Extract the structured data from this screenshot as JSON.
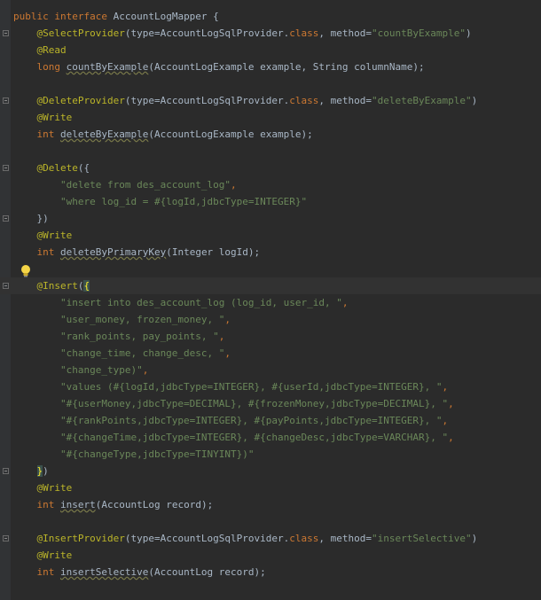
{
  "editor": {
    "lines": [
      {
        "tokens": [
          {
            "t": "public interface ",
            "c": "kw"
          },
          {
            "t": "AccountLogMapper {",
            "c": "cls"
          }
        ]
      },
      {
        "tokens": [
          {
            "t": "    @SelectProvider",
            "c": "ann"
          },
          {
            "t": "(type=AccountLogSqlProvider.",
            "c": "cls"
          },
          {
            "t": "class",
            "c": "kw"
          },
          {
            "t": ", method=",
            "c": "cls"
          },
          {
            "t": "\"countByExample\"",
            "c": "str"
          },
          {
            "t": ")",
            "c": "cls"
          }
        ]
      },
      {
        "tokens": [
          {
            "t": "    @Read",
            "c": "ann"
          }
        ]
      },
      {
        "tokens": [
          {
            "t": "    long ",
            "c": "kw"
          },
          {
            "t": "countByExample",
            "c": "meth"
          },
          {
            "t": "(AccountLogExample example, String columnName);",
            "c": "cls"
          }
        ]
      },
      {
        "tokens": []
      },
      {
        "tokens": [
          {
            "t": "    @DeleteProvider",
            "c": "ann"
          },
          {
            "t": "(type=AccountLogSqlProvider.",
            "c": "cls"
          },
          {
            "t": "class",
            "c": "kw"
          },
          {
            "t": ", method=",
            "c": "cls"
          },
          {
            "t": "\"deleteByExample\"",
            "c": "str"
          },
          {
            "t": ")",
            "c": "cls"
          }
        ]
      },
      {
        "tokens": [
          {
            "t": "    @Write",
            "c": "ann"
          }
        ]
      },
      {
        "tokens": [
          {
            "t": "    int ",
            "c": "kw"
          },
          {
            "t": "deleteByExample",
            "c": "meth"
          },
          {
            "t": "(AccountLogExample example);",
            "c": "cls"
          }
        ]
      },
      {
        "tokens": []
      },
      {
        "tokens": [
          {
            "t": "    @Delete",
            "c": "ann"
          },
          {
            "t": "({",
            "c": "cls"
          }
        ]
      },
      {
        "tokens": [
          {
            "t": "        \"delete from des_account_log\"",
            "c": "str"
          },
          {
            "t": ",",
            "c": "kw"
          }
        ]
      },
      {
        "tokens": [
          {
            "t": "        \"where log_id = #{logId,jdbcType=INTEGER}\"",
            "c": "str"
          }
        ]
      },
      {
        "tokens": [
          {
            "t": "    })",
            "c": "cls"
          }
        ]
      },
      {
        "tokens": [
          {
            "t": "    @Write",
            "c": "ann"
          }
        ]
      },
      {
        "tokens": [
          {
            "t": "    int ",
            "c": "kw"
          },
          {
            "t": "deleteByPrimaryKey",
            "c": "meth"
          },
          {
            "t": "(Integer logId);",
            "c": "cls"
          }
        ]
      },
      {
        "tokens": []
      },
      {
        "tokens": [
          {
            "t": "    @Insert",
            "c": "ann"
          },
          {
            "t": "(",
            "c": "cls"
          },
          {
            "t": "{",
            "c": "bracket-hl"
          }
        ],
        "current": true
      },
      {
        "tokens": [
          {
            "t": "        \"insert into des_account_log (log_id, user_id, \"",
            "c": "str"
          },
          {
            "t": ",",
            "c": "kw"
          }
        ]
      },
      {
        "tokens": [
          {
            "t": "        \"user_money, frozen_money, \"",
            "c": "str"
          },
          {
            "t": ",",
            "c": "kw"
          }
        ]
      },
      {
        "tokens": [
          {
            "t": "        \"rank_points, pay_points, \"",
            "c": "str"
          },
          {
            "t": ",",
            "c": "kw"
          }
        ]
      },
      {
        "tokens": [
          {
            "t": "        \"change_time, change_desc, \"",
            "c": "str"
          },
          {
            "t": ",",
            "c": "kw"
          }
        ]
      },
      {
        "tokens": [
          {
            "t": "        \"change_type)\"",
            "c": "str"
          },
          {
            "t": ",",
            "c": "kw"
          }
        ]
      },
      {
        "tokens": [
          {
            "t": "        \"values (#{logId,jdbcType=INTEGER}, #{userId,jdbcType=INTEGER}, \"",
            "c": "str"
          },
          {
            "t": ",",
            "c": "kw"
          }
        ]
      },
      {
        "tokens": [
          {
            "t": "        \"#{userMoney,jdbcType=DECIMAL}, #{frozenMoney,jdbcType=DECIMAL}, \"",
            "c": "str"
          },
          {
            "t": ",",
            "c": "kw"
          }
        ]
      },
      {
        "tokens": [
          {
            "t": "        \"#{rankPoints,jdbcType=INTEGER}, #{payPoints,jdbcType=INTEGER}, \"",
            "c": "str"
          },
          {
            "t": ",",
            "c": "kw"
          }
        ]
      },
      {
        "tokens": [
          {
            "t": "        \"#{changeTime,jdbcType=INTEGER}, #{changeDesc,jdbcType=VARCHAR}, \"",
            "c": "str"
          },
          {
            "t": ",",
            "c": "kw"
          }
        ]
      },
      {
        "tokens": [
          {
            "t": "        \"#{changeType,jdbcType=TINYINT})\"",
            "c": "str"
          }
        ]
      },
      {
        "tokens": [
          {
            "t": "    ",
            "c": "cls"
          },
          {
            "t": "}",
            "c": "bracket-hl"
          },
          {
            "t": ")",
            "c": "cls"
          }
        ]
      },
      {
        "tokens": [
          {
            "t": "    @Write",
            "c": "ann"
          }
        ]
      },
      {
        "tokens": [
          {
            "t": "    int ",
            "c": "kw"
          },
          {
            "t": "insert",
            "c": "meth"
          },
          {
            "t": "(AccountLog record);",
            "c": "cls"
          }
        ]
      },
      {
        "tokens": []
      },
      {
        "tokens": [
          {
            "t": "    @InsertProvider",
            "c": "ann"
          },
          {
            "t": "(type=AccountLogSqlProvider.",
            "c": "cls"
          },
          {
            "t": "class",
            "c": "kw"
          },
          {
            "t": ", method=",
            "c": "cls"
          },
          {
            "t": "\"insertSelective\"",
            "c": "str"
          },
          {
            "t": ")",
            "c": "cls"
          }
        ]
      },
      {
        "tokens": [
          {
            "t": "    @Write",
            "c": "ann"
          }
        ]
      },
      {
        "tokens": [
          {
            "t": "    int ",
            "c": "kw"
          },
          {
            "t": "insertSelective",
            "c": "meth"
          },
          {
            "t": "(AccountLog record);",
            "c": "cls"
          }
        ]
      }
    ],
    "fold_markers": [
      1,
      5,
      9,
      12,
      16,
      27,
      31
    ],
    "intention_icon": "lightbulb-icon",
    "colors": {
      "background": "#2b2b2b",
      "gutter": "#313335",
      "keyword": "#cc7832",
      "annotation": "#bbb529",
      "string": "#6a8759",
      "text": "#a9b7c6",
      "current_line": "#323232",
      "bracket_match_bg": "#3b514d",
      "bracket_match_fg": "#ffef28"
    }
  }
}
